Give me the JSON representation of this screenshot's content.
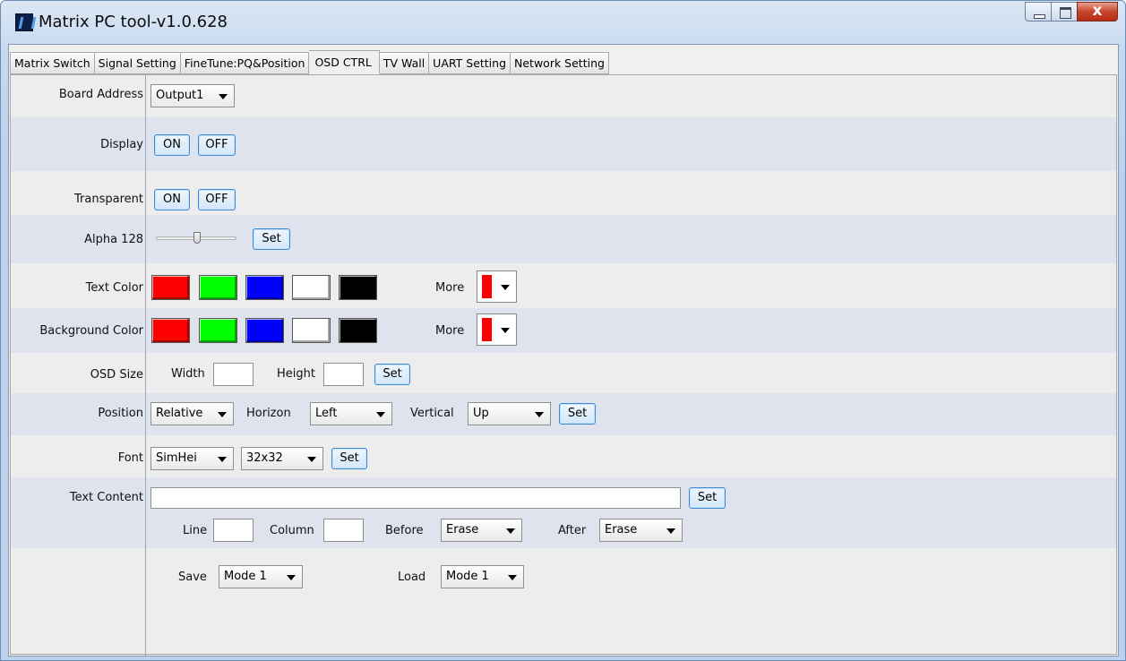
{
  "window": {
    "title": "Matrix PC tool-v1.0.628"
  },
  "tabs": [
    {
      "label": "Matrix Switch"
    },
    {
      "label": "Signal Setting"
    },
    {
      "label": "FineTune:PQ&Position"
    },
    {
      "label": "OSD CTRL"
    },
    {
      "label": "TV Wall"
    },
    {
      "label": "UART Setting"
    },
    {
      "label": "Network Setting"
    }
  ],
  "active_tab": "OSD CTRL",
  "osd": {
    "board_address": {
      "label": "Board Address",
      "value": "Output1"
    },
    "display": {
      "label": "Display",
      "on": "ON",
      "off": "OFF"
    },
    "transparent": {
      "label": "Transparent",
      "on": "ON",
      "off": "OFF"
    },
    "alpha": {
      "label": "Alpha 128",
      "value": 128,
      "max": 255,
      "set": "Set"
    },
    "text_color": {
      "label": "Text Color",
      "more": "More",
      "selected": "#ff0000"
    },
    "background_color": {
      "label": "Background Color",
      "more": "More",
      "selected": "#ff0000"
    },
    "swatches": [
      "#ff0000",
      "#00ff00",
      "#0000ff",
      "#ffffff",
      "#000000"
    ],
    "osd_size": {
      "label": "OSD Size",
      "width_label": "Width",
      "height_label": "Height",
      "width": "",
      "height": "",
      "set": "Set"
    },
    "position": {
      "label": "Position",
      "mode": "Relative",
      "horizon_label": "Horizon",
      "horizon": "Left",
      "vertical_label": "Vertical",
      "vertical": "Up",
      "set": "Set"
    },
    "font": {
      "label": "Font",
      "family": "SimHei",
      "size": "32x32",
      "set": "Set"
    },
    "text_content": {
      "label": "Text Content",
      "value": "",
      "set": "Set",
      "line_label": "Line",
      "line": "",
      "column_label": "Column",
      "column": "",
      "before_label": "Before",
      "before": "Erase",
      "after_label": "After",
      "after": "Erase"
    },
    "save_load": {
      "save_label": "Save",
      "save_mode": "Mode 1",
      "load_label": "Load",
      "load_mode": "Mode 1"
    }
  }
}
